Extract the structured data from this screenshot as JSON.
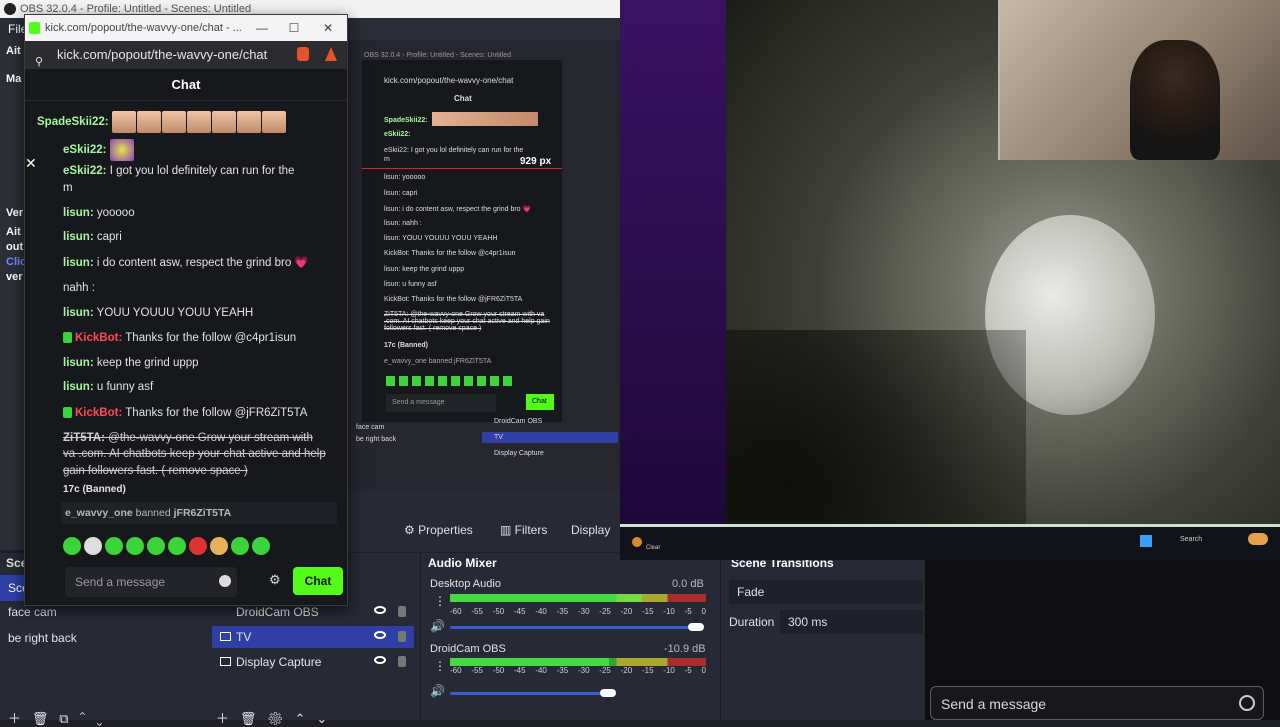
{
  "obs": {
    "title": "OBS 32.0.4 - Profile: Untitled - Scenes: Untitled",
    "menu_file": "File",
    "strip": {
      "a": "Ait",
      "b": "Ma",
      "c": "Ver",
      "d": "Ait",
      "e": "out",
      "f": "Clic",
      "g": "ver",
      "h": "Sce"
    }
  },
  "chat": {
    "window_title": "kick.com/popout/the-wavvy-one/chat - ...",
    "url": "kick.com/popout/the-wavvy-one/chat",
    "header": "Chat",
    "messages": [
      {
        "user": "SpadeSkii22:",
        "text": ""
      },
      {
        "user": "eSkii22:",
        "text": ""
      },
      {
        "user": "eSkii22:",
        "text": "I got you lol definitely can run for the"
      },
      {
        "user": "",
        "text": "m"
      },
      {
        "user": "lisun:",
        "text": "yooooo"
      },
      {
        "user": "lisun:",
        "text": "capri"
      },
      {
        "user": "lisun:",
        "text": "i do content asw, respect the grind bro 💗"
      },
      {
        "user": "",
        "text": "nahh :"
      },
      {
        "user": "lisun:",
        "text": "YOUU YOUUU YOUU YEAHH"
      },
      {
        "user": "KickBot:",
        "text": "Thanks for the follow @c4pr1isun"
      },
      {
        "user": "lisun:",
        "text": "keep the grind uppp"
      },
      {
        "user": "lisun:",
        "text": "u funny asf"
      },
      {
        "user": "KickBot:",
        "text": "Thanks for the follow @jFR6ZiT5TA"
      }
    ],
    "spam_user": "ZiT5TA:",
    "spam_text_1": "@the-wavvy-one Grow your stream with",
    "spam_text_2": "va .com. AI chatbots keep your chat active and help",
    "spam_text_3": "gain followers fast. ( remove space )",
    "spam_tag": "17c (Banned)",
    "ban_user": "e_wavvy_one",
    "ban_word": "banned",
    "ban_target": "jFR6ZiT5TA",
    "input_placeholder": "Send a message",
    "send_label": "Chat",
    "close": "✕"
  },
  "nested": {
    "title": "OBS 32.0.4 - Profile: Untitled - Scenes: Untitled",
    "url": "kick.com/popout/the-wavvy-one/chat",
    "header": "Chat",
    "px": "929 px",
    "lines": [
      "SpadeSkii22:",
      "eSkii22:",
      "eSkii22: I got you lol definitely can run for the",
      "m",
      "lisun: yooooo",
      "lisun: capri",
      "lisun: i do content asw, respect the grind bro 💗",
      "lisun: nahh :",
      "lisun: YOUU YOUUU YOUU YEAHH",
      "KickBot: Thanks for the follow @c4pr1isun",
      "lisun: keep the grind uppp",
      "lisun: u funny asf",
      "KickBot: Thanks for the follow @jFR6ZiT5TA"
    ],
    "spam": "ZiT5TA: @the-wavvy-one Grow your stream with va .com. AI chatbots keep your chat active and help gain followers fast. ( remove space )",
    "spam_tag": "17c (Banned)",
    "ban": "e_wavvy_one banned jFR6ZiT5TA",
    "input": "Send a message",
    "send": "Chat",
    "sources": [
      "DroidCam OBS",
      "TV",
      "Display Capture"
    ],
    "scenes": [
      "face cam",
      "be right back"
    ]
  },
  "controls": {
    "properties": "Properties",
    "filters": "Filters",
    "display": "Display"
  },
  "scenes": {
    "title": "Sce",
    "items": [
      "Sce",
      "face cam",
      "be right back"
    ]
  },
  "sources": {
    "items": [
      "DroidCam OBS",
      "TV",
      "Display Capture"
    ]
  },
  "audio": {
    "title": "Audio Mixer",
    "tracks": [
      {
        "name": "Desktop Audio",
        "db": "0.0 dB",
        "level": 0.75
      },
      {
        "name": "DroidCam OBS",
        "db": "-10.9 dB",
        "level": 0.62
      }
    ],
    "scale": [
      "-60",
      "-55",
      "-50",
      "-45",
      "-40",
      "-35",
      "-30",
      "-25",
      "-20",
      "-15",
      "-10",
      "-5",
      "0"
    ]
  },
  "transitions": {
    "title": "Scene Transitions",
    "type": "Fade",
    "duration_label": "Duration",
    "duration": "300 ms"
  },
  "taskbar": {
    "search": "Search",
    "weather": "Clear"
  },
  "bottom": {
    "placeholder": "Send a message"
  }
}
